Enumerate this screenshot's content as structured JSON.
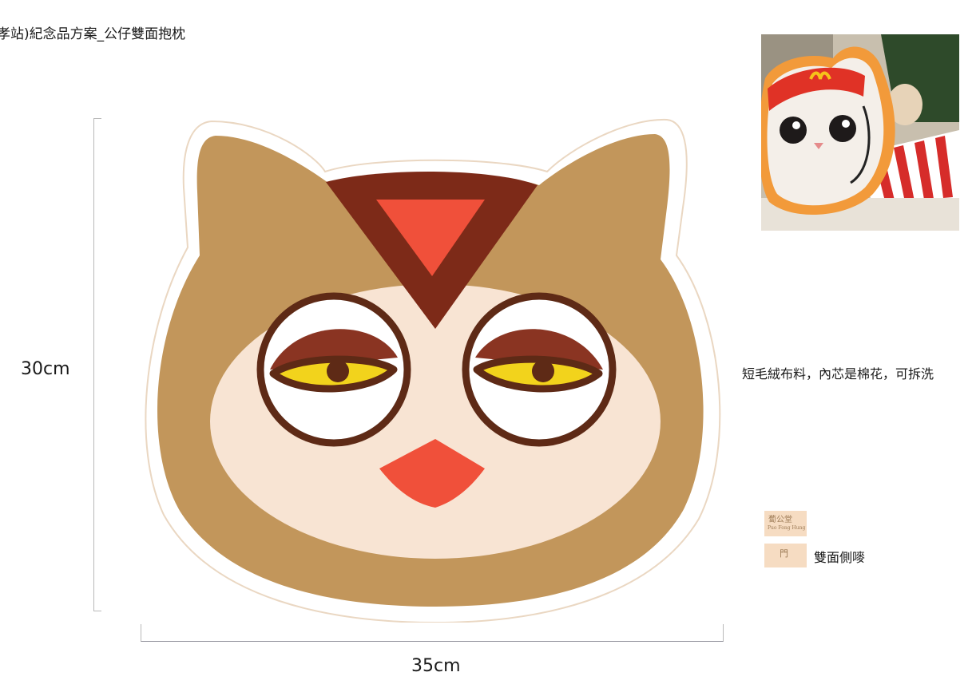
{
  "title": "孝站)紀念品方案_公仔雙面抱枕",
  "dimensions": {
    "height": "30cm",
    "width": "35cm"
  },
  "description": "短毛絨布料，內芯是棉花，可拆洗",
  "legend": {
    "brand_logo_text": "蔔公堂",
    "brand_logo_subtext": "Puo Fong Hung",
    "side_swatch_text": "門",
    "side_label": "雙面側嘜"
  },
  "colors": {
    "owl_outer": "#c2965b",
    "owl_face": "#f8e4d3",
    "owl_dark_brown": "#7d2a18",
    "owl_red": "#f0503a",
    "owl_eye_yellow": "#f2d31c",
    "owl_pupil": "#5e2a16",
    "swatch": "#f6dcc2"
  }
}
